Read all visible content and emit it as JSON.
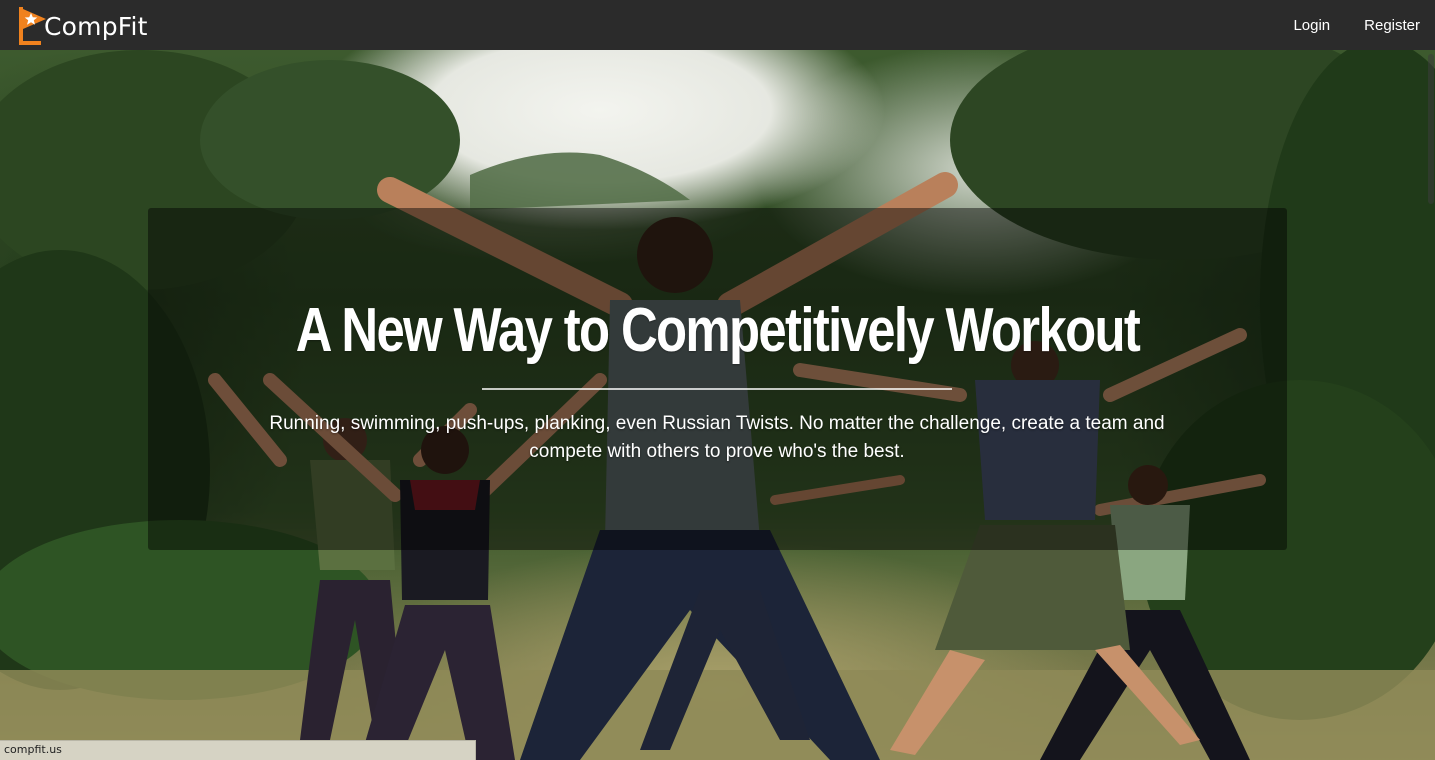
{
  "navbar": {
    "brand": "CompFit",
    "brand_logo_icon": "flag-star-icon",
    "links": [
      "Login",
      "Register"
    ]
  },
  "hero": {
    "title": "A New Way to Competitively Workout",
    "subtitle": "Running, swimming, push-ups, planking, even Russian Twists. No matter the challenge, create a team and compete with others to prove who's the best."
  },
  "statusbar": {
    "url": "compfit.us"
  },
  "colors": {
    "navbar_bg": "#2b2b2b",
    "logo_orange": "#f0821e",
    "text": "#ffffff"
  }
}
